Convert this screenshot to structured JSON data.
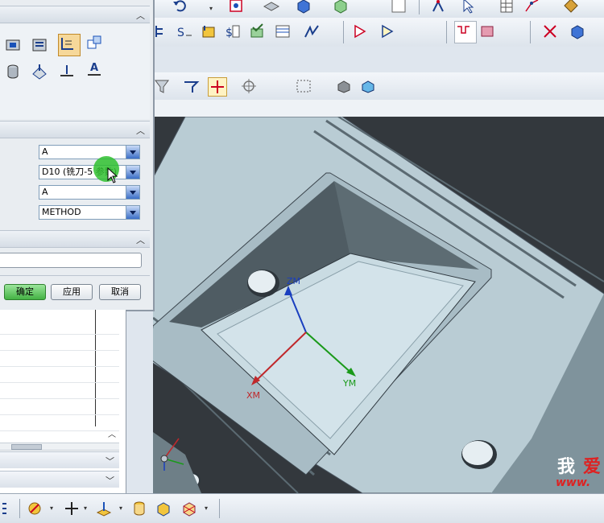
{
  "dialog": {
    "combos": [
      {
        "value": "A"
      },
      {
        "value": "D10 (铣刀-5 参数)"
      },
      {
        "value": "A"
      },
      {
        "value": "METHOD"
      }
    ],
    "buttons": {
      "ok": "确定",
      "apply": "应用",
      "cancel": "取消"
    }
  },
  "viewport": {
    "axes": {
      "zm": "ZM",
      "ym": "YM",
      "xm": "XM"
    }
  },
  "watermark": {
    "char": "我",
    "char2": "爱",
    "url": "www."
  },
  "colors": {
    "accent_green": "#2fbf2f",
    "axis_z": "#1a3fbf",
    "axis_y": "#1a9a1a",
    "axis_x": "#c0282b",
    "part": "#c9dbe2"
  },
  "icons": {
    "top_toolbar": [
      "undo-icon",
      "snap-point-icon",
      "layer-icon",
      "solid-box-icon",
      "feature-icon",
      "color-box-icon",
      "wcs-icon",
      "arrow-select-icon",
      "table-icon",
      "curve-icon",
      "analysis-icon"
    ],
    "second_toolbar": [
      "operation-nav-icon",
      "sequence-icon",
      "tool-path-icon",
      "post-process-icon",
      "verify-icon",
      "shop-doc-icon",
      "display-path-icon",
      "generate-icon",
      "replay-icon",
      "pattern-icon",
      "ipw-icon",
      "cut-region-icon",
      "orient-icon"
    ],
    "third_toolbar": [
      "filter-icon",
      "snap-icon",
      "point-icon",
      "locate-icon",
      "select-box-icon",
      "shaded-icon",
      "wireframe-icon"
    ],
    "bottom_toolbar": [
      "menu-icon",
      "csys-icon",
      "plus-icon",
      "datum-icon",
      "cylinder-icon",
      "block-icon",
      "assembly-icon"
    ]
  }
}
